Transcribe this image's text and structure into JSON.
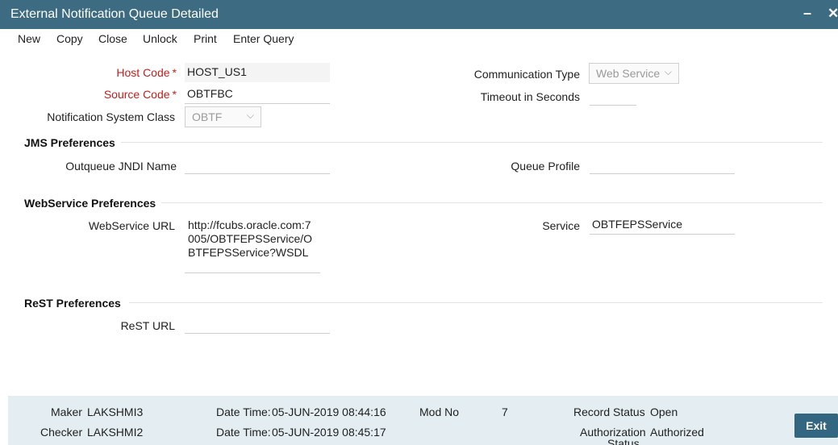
{
  "window": {
    "title": "External Notification Queue Detailed"
  },
  "menu": [
    "New",
    "Copy",
    "Close",
    "Unlock",
    "Print",
    "Enter Query"
  ],
  "form": {
    "host_code": {
      "label": "Host Code",
      "value": "HOST_US1"
    },
    "source_code": {
      "label": "Source Code",
      "value": "OBTFBC"
    },
    "notification_system_class": {
      "label": "Notification System Class",
      "value": "OBTF"
    },
    "communication_type": {
      "label": "Communication Type",
      "value": "Web Service"
    },
    "timeout": {
      "label": "Timeout in Seconds",
      "value": ""
    }
  },
  "jms": {
    "heading": "JMS Preferences",
    "outqueue_label": "Outqueue JNDI Name",
    "outqueue_value": "",
    "queue_profile_label": "Queue Profile",
    "queue_profile_value": ""
  },
  "webservice": {
    "heading": "WebService Preferences",
    "url_label": "WebService URL",
    "url_value": "http://fcubs.oracle.com:7005/OBTFEPSService/OBTFEPSService?WSDL",
    "service_label": "Service",
    "service_value": "OBTFEPSService"
  },
  "rest": {
    "heading": "ReST Preferences",
    "url_label": "ReST URL",
    "url_value": ""
  },
  "footer": {
    "maker_label": "Maker",
    "maker": "LAKSHMI3",
    "checker_label": "Checker",
    "checker": "LAKSHMI2",
    "datetime_label": "Date Time:",
    "maker_datetime": "05-JUN-2019 08:44:16",
    "checker_datetime": "05-JUN-2019 08:45:17",
    "modno_label": "Mod No",
    "modno": "7",
    "record_status_label": "Record Status",
    "record_status": "Open",
    "auth_status_label_1": "Authorization",
    "auth_status_label_2": "Status",
    "auth_status": "Authorized",
    "exit_label": "Exit"
  }
}
